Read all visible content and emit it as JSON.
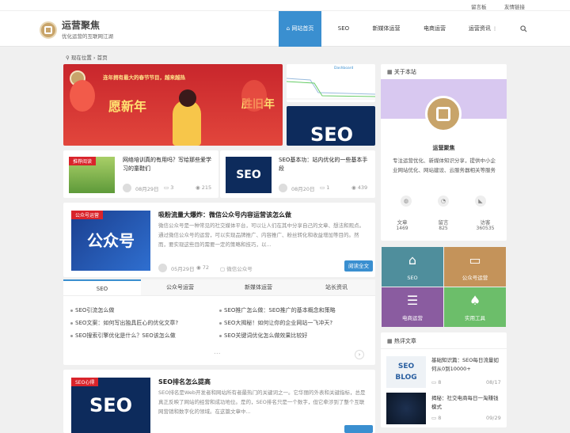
{
  "topbar": {
    "links": [
      "留言板",
      "友情链接"
    ]
  },
  "header": {
    "site_name": "运营聚焦",
    "site_desc": "优化运营的互联网江湖",
    "nav": [
      "网站首页",
      "SEO",
      "新媒体运营",
      "电商运营",
      "运营资讯"
    ],
    "active_nav": "网站首页",
    "search_icon": "search-icon",
    "dropdown_icon": "chevron-down-icon"
  },
  "breadcrumb": {
    "prefix": "现在位置",
    "home": "首页"
  },
  "slider": {
    "main_text1": "连年拥有最大的春节节目，越来越热",
    "main_text2": "愿新年",
    "main_text3": "胜旧年",
    "side_text": "SEO",
    "side_chart_label": "Dashboard"
  },
  "featured": [
    {
      "tag": "推荐阅读",
      "title": "网络培训真的有用吗？写给那些爱学习的童鞋们",
      "date": "08月29日",
      "comments": "3",
      "views": "215"
    },
    {
      "title": "SEO基本功：站内优化的一些基本手段",
      "thumb_text": "SEO",
      "date": "08月20日",
      "comments": "1",
      "views": "439"
    }
  ],
  "post1": {
    "tag": "公众号运营",
    "thumb_text": "公众号",
    "title": "吸粉流量大爆炸：微信公众号内容运营该怎么做",
    "excerpt": "微信公众号是一种常见的社交媒体平台，可以让人们在其中分享自己的文章、想法和观点。通过微信公众号的运营，可以实现品牌推广、内容推广、粉丝转化和收益增加等目的。然而，要实现这些目的需要一定的策略和技巧，以...",
    "date": "05月29日",
    "views": "72",
    "category": "微信公众号",
    "read_more": "阅读全文"
  },
  "tabs": {
    "labels": [
      "SEO",
      "公众号运营",
      "新媒体运营",
      "站长资讯"
    ],
    "active": "SEO",
    "items": [
      "SEO引流怎么做",
      "SEO推广怎么做：SEO推广的基本概念和策略",
      "SEO文案：如何写出独具匠心的优化文章?",
      "SEO大揭秘！如何让你的企业网站一飞冲天?",
      "SEO搜索引擎优化是什么？SEO该怎么做",
      "SEO关键词优化怎么做效果比较好"
    ],
    "more": "..."
  },
  "post2": {
    "tag": "SEO心得",
    "thumb_text": "SEO",
    "title": "SEO排名怎么提高",
    "excerpt": "SEO排名是Web开发者和网站所有者最热门的关键词之一。它华丽的外表和关键指标，总是真正反映了网站的经营和成功地位。是的，SEO排名只是一个数字，但它牵涉到了整个互联网营销和数字化的领域。在这篇文章中..."
  },
  "about": {
    "title": "关于本站",
    "name": "运营聚焦",
    "desc": "专注运营优化、新媒体知识分享，提供中小企业网站优化、网站建设、云服务器相关等服务",
    "stats": [
      {
        "label": "文章",
        "value": "1469"
      },
      {
        "label": "留言",
        "value": "825"
      },
      {
        "label": "访客",
        "value": "360535"
      }
    ],
    "icons": [
      "wechat-icon",
      "qq-icon",
      "rss-icon"
    ]
  },
  "grid": [
    {
      "label": "SEO",
      "color": "#4f8e9c",
      "icon": "home-icon"
    },
    {
      "label": "公众号运营",
      "color": "#c4935a",
      "icon": "folder-icon"
    },
    {
      "label": "电商运营",
      "color": "#8a5ca0",
      "icon": "list-icon"
    },
    {
      "label": "实用工具",
      "color": "#6cbe6a",
      "icon": "thumb-up-icon"
    }
  ],
  "hot": {
    "title": "热评文章",
    "items": [
      {
        "title": "基础知识篇：SEO每日流量如何从0到10000+",
        "comments": "8",
        "date": "08/17"
      },
      {
        "title": "揭秘：社交电商每日一淘赚钱模式",
        "comments": "8",
        "date": "09/29"
      }
    ]
  }
}
